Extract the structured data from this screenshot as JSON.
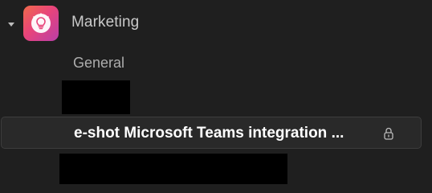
{
  "team": {
    "name": "Marketing",
    "avatar_icon": "lightbulb-icon",
    "expand_icon": "caret-down-icon"
  },
  "channels": {
    "general": "General",
    "active": {
      "label": "e-shot Microsoft Teams integration ...",
      "icon": "lock-icon"
    }
  },
  "colors": {
    "background": "#1f1f1f",
    "active_row": "#292929",
    "avatar_gradient": [
      "#f06a4a",
      "#e8447a",
      "#b93fa8"
    ]
  }
}
